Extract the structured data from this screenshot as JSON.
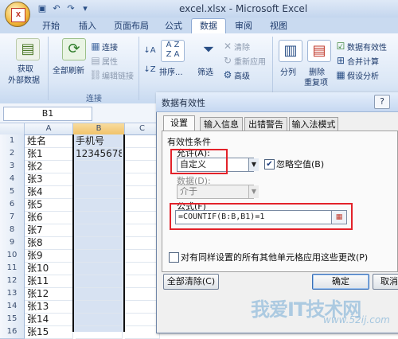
{
  "window": {
    "title": "excel.xlsx - Microsoft Excel"
  },
  "tabs": [
    "开始",
    "插入",
    "页面布局",
    "公式",
    "数据",
    "审阅",
    "视图"
  ],
  "active_tab": "数据",
  "ribbon": {
    "get_external": [
      "获取",
      "外部数据"
    ],
    "refresh_all": "全部刷新",
    "connections": "连接",
    "properties": "属性",
    "edit_links": "编辑链接",
    "connections_group": "连接",
    "sort": "排序...",
    "filter": "筛选",
    "clear": "清除",
    "reapply": "重新应用",
    "advanced": "高级",
    "text_to_columns": "分列",
    "remove_dup": [
      "删除",
      "重复项"
    ],
    "data_validation": "数据有效性",
    "consolidate": "合并计算",
    "what_if": "假设分析"
  },
  "formula_bar": {
    "name_box": "B1"
  },
  "sheet": {
    "columns": [
      "A",
      "B",
      "C"
    ],
    "rows": [
      {
        "num": "1",
        "a": "姓名",
        "b": "手机号"
      },
      {
        "num": "2",
        "a": "张1",
        "b": "12345678"
      },
      {
        "num": "3",
        "a": "张2",
        "b": ""
      },
      {
        "num": "4",
        "a": "张3",
        "b": ""
      },
      {
        "num": "5",
        "a": "张4",
        "b": ""
      },
      {
        "num": "6",
        "a": "张5",
        "b": ""
      },
      {
        "num": "7",
        "a": "张6",
        "b": ""
      },
      {
        "num": "8",
        "a": "张7",
        "b": ""
      },
      {
        "num": "9",
        "a": "张8",
        "b": ""
      },
      {
        "num": "10",
        "a": "张9",
        "b": ""
      },
      {
        "num": "11",
        "a": "张10",
        "b": ""
      },
      {
        "num": "12",
        "a": "张11",
        "b": ""
      },
      {
        "num": "13",
        "a": "张12",
        "b": ""
      },
      {
        "num": "14",
        "a": "张13",
        "b": ""
      },
      {
        "num": "15",
        "a": "张14",
        "b": ""
      },
      {
        "num": "16",
        "a": "张15",
        "b": ""
      }
    ]
  },
  "dialog": {
    "title": "数据有效性",
    "help": "?",
    "tabs": [
      "设置",
      "输入信息",
      "出错警告",
      "输入法模式"
    ],
    "criteria": "有效性条件",
    "allow_label": "允许(A):",
    "allow_value": "自定义",
    "ignore_blank": "忽略空值(B)",
    "data_label": "数据(D):",
    "data_value": "介于",
    "formula_label": "公式(F)",
    "formula_value": "=COUNTIF(B:B,B1)=1",
    "apply_all": "对有同样设置的所有其他单元格应用这些更改(P)",
    "clear_all": "全部清除(C)",
    "ok": "确定",
    "cancel": "取消"
  },
  "watermark": {
    "cn": "我爱IT技术网",
    "url": "www.52ij.com"
  },
  "colors": {
    "highlight_box": "#e3222a",
    "selection": "#d7e2f2",
    "ribbon": "#dbe7f6"
  }
}
